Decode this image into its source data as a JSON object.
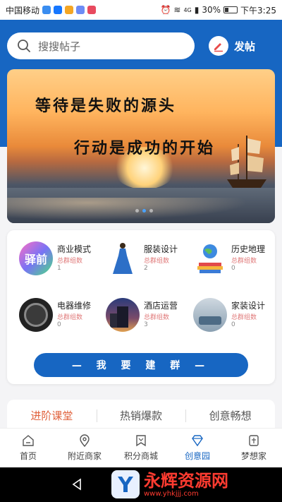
{
  "statusbar": {
    "carrier": "中国移动",
    "signal": "4G",
    "battery": "30%",
    "time": "下午3:25"
  },
  "search": {
    "placeholder": "搜搜帖子"
  },
  "post": {
    "label": "发帖"
  },
  "banner": {
    "line1": "等待是失败的源头",
    "line2": "行动是成功的开始",
    "dots": 3,
    "active_dot": 1
  },
  "categories": [
    {
      "name": "商业模式",
      "sub": "总群组数",
      "count": "1",
      "pic_text": "驿前"
    },
    {
      "name": "服装设计",
      "sub": "总群组数",
      "count": "2"
    },
    {
      "name": "历史地理",
      "sub": "总群组数",
      "count": "0"
    },
    {
      "name": "电器维修",
      "sub": "总群组数",
      "count": "0"
    },
    {
      "name": "酒店运营",
      "sub": "总群组数",
      "count": "3"
    },
    {
      "name": "家装设计",
      "sub": "总群组数",
      "count": "0"
    }
  ],
  "build_button": "— 我 要 建 群 —",
  "tabs": [
    "进阶课堂",
    "热销爆款",
    "创意畅想"
  ],
  "nav": [
    {
      "label": "首页",
      "icon": "home-icon"
    },
    {
      "label": "附近商家",
      "icon": "location-icon"
    },
    {
      "label": "积分商城",
      "icon": "bookmark-icon"
    },
    {
      "label": "创意园",
      "icon": "diamond-icon",
      "active": true
    },
    {
      "label": "梦想家",
      "icon": "dream-icon"
    }
  ],
  "watermark": {
    "title": "永辉资源网",
    "url": "www.yhkjjj.com"
  },
  "colors": {
    "brand": "#1766c2",
    "accent": "#e0603a"
  }
}
